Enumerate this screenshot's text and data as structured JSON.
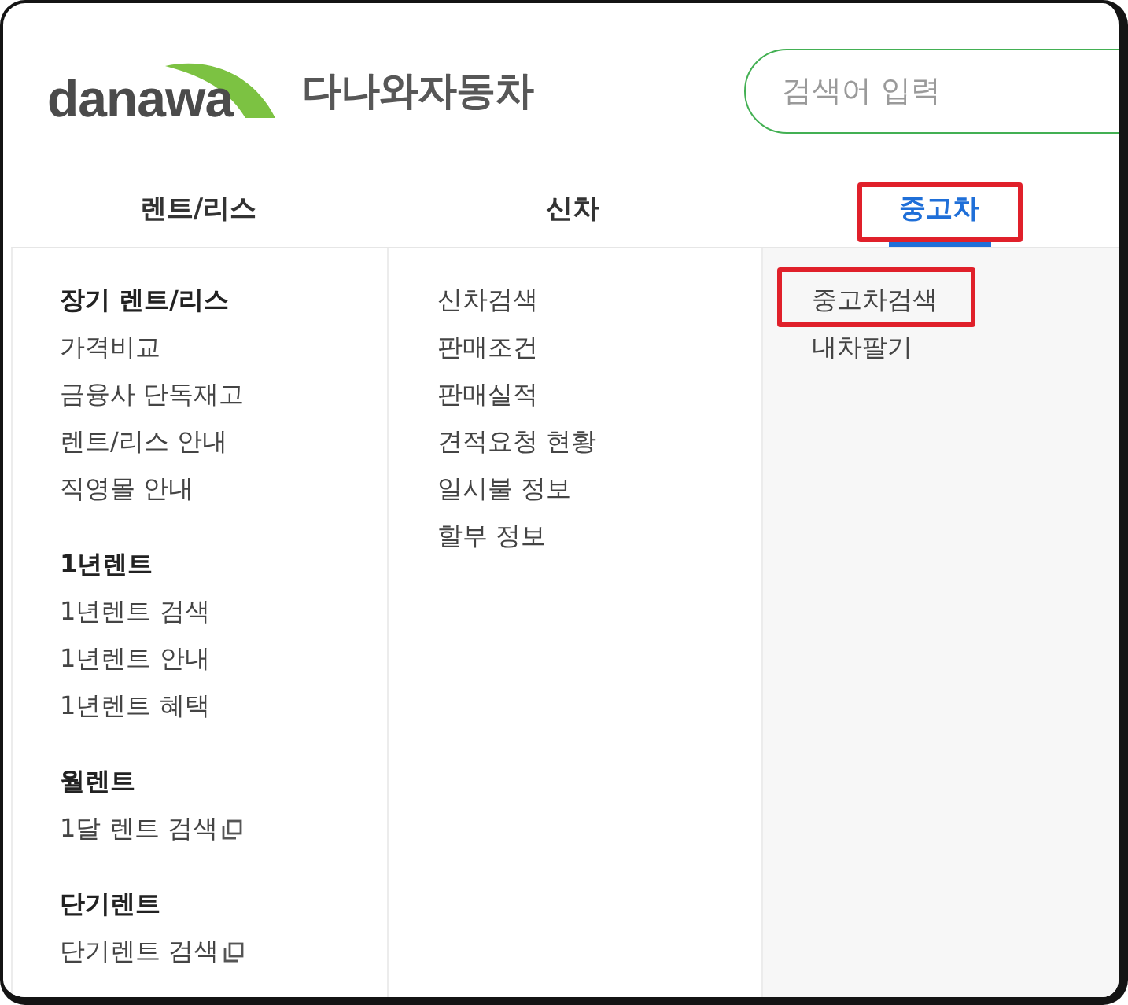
{
  "brand": {
    "logo_text": "danawa",
    "site_name": "다나와자동차"
  },
  "search": {
    "placeholder": "검색어 입력"
  },
  "tabs": [
    {
      "label": "렌트/리스",
      "selected": false,
      "highlighted": false
    },
    {
      "label": "신차",
      "selected": false,
      "highlighted": false
    },
    {
      "label": "중고차",
      "selected": true,
      "highlighted": true
    }
  ],
  "menu_columns": [
    {
      "groups": [
        {
          "heading": "장기 렌트/리스",
          "items": [
            {
              "label": "가격비교",
              "external": false,
              "highlighted": false
            },
            {
              "label": "금융사 단독재고",
              "external": false,
              "highlighted": false
            },
            {
              "label": "렌트/리스 안내",
              "external": false,
              "highlighted": false
            },
            {
              "label": "직영몰 안내",
              "external": false,
              "highlighted": false
            }
          ]
        },
        {
          "heading": "1년렌트",
          "items": [
            {
              "label": "1년렌트 검색",
              "external": false,
              "highlighted": false
            },
            {
              "label": "1년렌트 안내",
              "external": false,
              "highlighted": false
            },
            {
              "label": "1년렌트 혜택",
              "external": false,
              "highlighted": false
            }
          ]
        },
        {
          "heading": "월렌트",
          "items": [
            {
              "label": "1달 렌트 검색",
              "external": true,
              "highlighted": false
            }
          ]
        },
        {
          "heading": "단기렌트",
          "items": [
            {
              "label": "단기렌트 검색",
              "external": true,
              "highlighted": false
            }
          ]
        }
      ]
    },
    {
      "groups": [
        {
          "items": [
            {
              "label": "신차검색",
              "external": false,
              "highlighted": false
            },
            {
              "label": "판매조건",
              "external": false,
              "highlighted": false
            },
            {
              "label": "판매실적",
              "external": false,
              "highlighted": false
            },
            {
              "label": "견적요청 현황",
              "external": false,
              "highlighted": false
            },
            {
              "label": "일시불 정보",
              "external": false,
              "highlighted": false
            },
            {
              "label": "할부 정보",
              "external": false,
              "highlighted": false
            }
          ]
        }
      ]
    },
    {
      "groups": [
        {
          "items": [
            {
              "label": "중고차검색",
              "external": false,
              "highlighted": true
            },
            {
              "label": "내차팔기",
              "external": false,
              "highlighted": false
            }
          ]
        }
      ]
    }
  ]
}
